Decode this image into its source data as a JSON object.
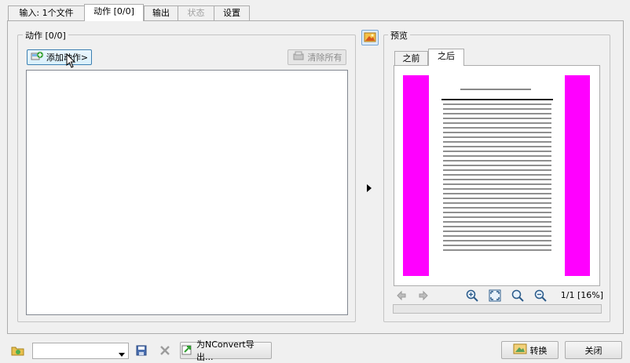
{
  "tabs": [
    {
      "label": "输入:  1个文件",
      "state": "normal"
    },
    {
      "label": "动作 [0/0]",
      "state": "active"
    },
    {
      "label": "输出",
      "state": "normal"
    },
    {
      "label": "状态",
      "state": "disabled"
    },
    {
      "label": "设置",
      "state": "normal"
    }
  ],
  "actions": {
    "group_title": "动作 [0/0]",
    "add_button": "添加动作>",
    "clear_button": "清除所有"
  },
  "preview": {
    "group_title": "预览",
    "tabs": [
      "之前",
      "之后"
    ],
    "active_tab": "之后",
    "page_indicator": "1/1 [16%]",
    "margin_color": "#ff00ff"
  },
  "bottom": {
    "script_select_value": "",
    "export_button": "为NConvert导出...",
    "convert_button": "转换",
    "close_button": "关闭"
  }
}
